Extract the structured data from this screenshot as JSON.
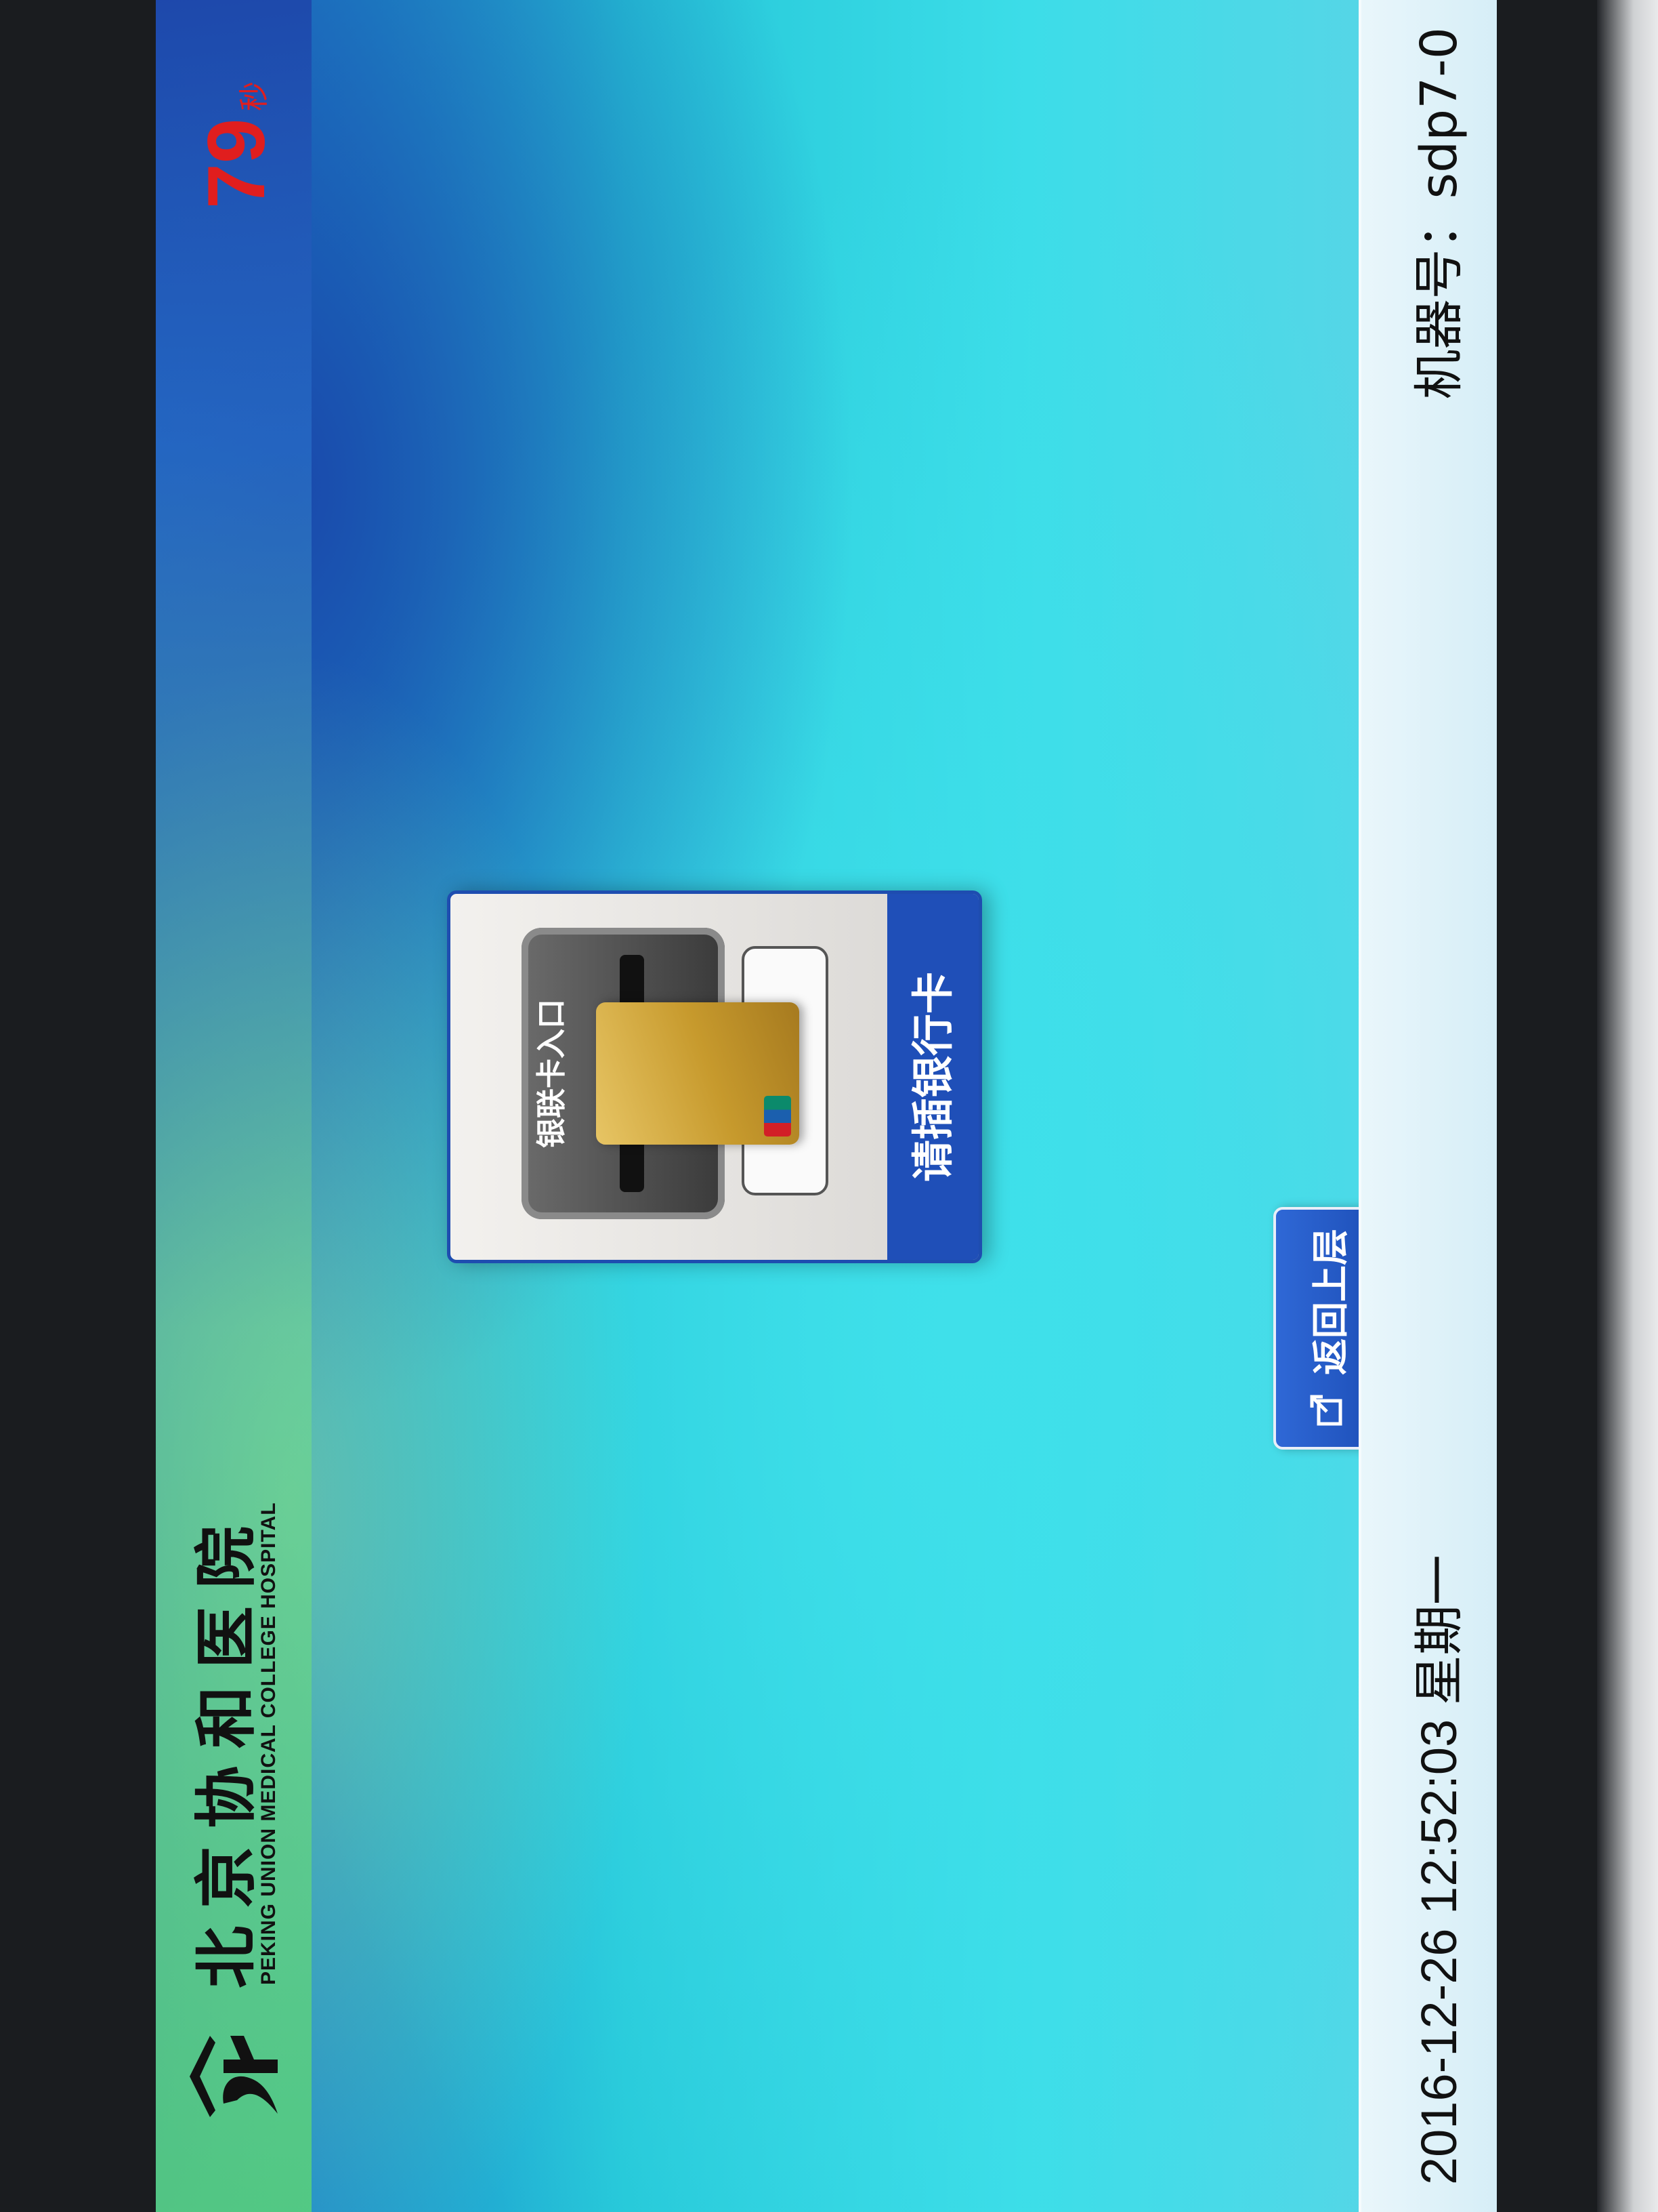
{
  "header": {
    "hospital_name_cn": "北京协和医院",
    "hospital_name_en": "PEKING UNION MEDICAL COLLEGE HOSPITAL",
    "countdown_value": "79",
    "countdown_unit": "秒"
  },
  "card_panel": {
    "title": "请插银行卡",
    "slot_label": "银联卡入口"
  },
  "actions": {
    "back_label": "返回上层"
  },
  "footer": {
    "datetime": "2016-12-26 12:52:03",
    "weekday": "星期一",
    "machine_label": "机器号：",
    "machine_id": "sdp7-0"
  },
  "colors": {
    "accent_blue": "#1f4fb8",
    "countdown_red": "#e01e1e",
    "header_green": "#5ad278"
  },
  "icons": [
    "hospital-logo-icon",
    "back-arrow-icon",
    "unionpay-logo-icon"
  ]
}
